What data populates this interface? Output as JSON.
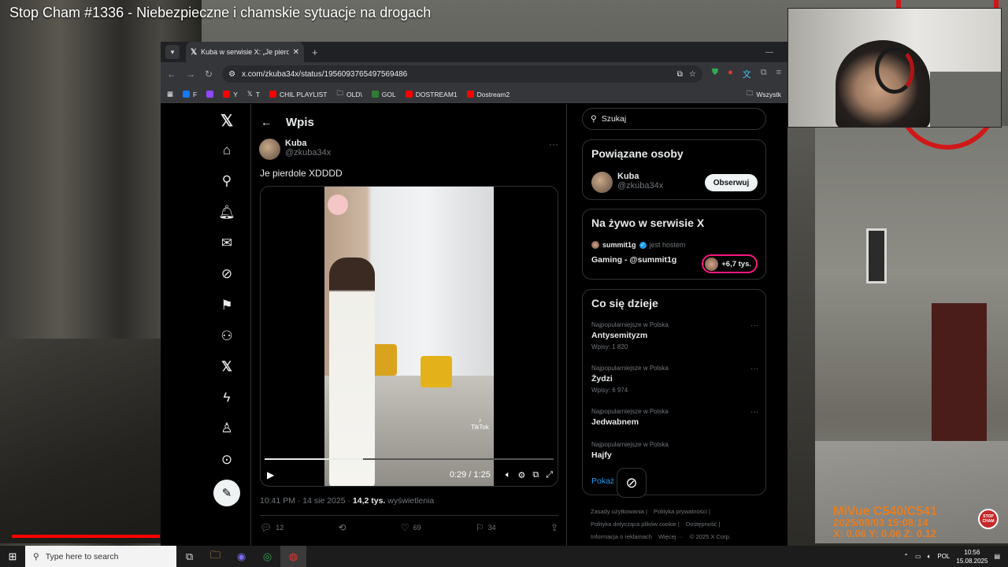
{
  "video_title": "Stop Cham #1336 - Niebezpieczne i chamskie sytuacje na drogach",
  "browser": {
    "tab_title": "Kuba w serwisie X: „Je pierdole",
    "url": "x.com/zkuba34x/status/1956093765497569486",
    "bookmarks": [
      "F",
      "Y",
      "T",
      "CHIL PLAYLIST",
      "OLD\\",
      "GOL",
      "DOSTREAM1",
      "Dostream2"
    ],
    "bookmarks_right": "Wszystk"
  },
  "x": {
    "header_title": "Wpis",
    "post": {
      "author_name": "Kuba",
      "author_handle": "@zkuba34x",
      "text": "Je pierdole XDDDD",
      "video_time": "0:29 / 1:25",
      "video_progress": 0.34,
      "tiktok_label": "TikTok",
      "time": "10:41 PM · 14 sie 2025 · ",
      "views": "14,2 tys.",
      "views_label": "wyświetlenia",
      "replies": "12",
      "likes": "69",
      "bookmarks": "34"
    },
    "search_placeholder": "Szukaj",
    "related": {
      "title": "Powiązane osoby",
      "name": "Kuba",
      "handle": "@zkuba34x",
      "follow_label": "Obserwuj"
    },
    "live": {
      "title": "Na żywo w serwisie X",
      "host_name": "summit1g",
      "host_suffix": "jest hostem",
      "stream_title": "Gaming - @summit1g",
      "count": "+6,7 tys."
    },
    "trends": {
      "title": "Co się dzieje",
      "items": [
        {
          "category": "Najpopularniejsze w Polska",
          "name": "Antysemityzm",
          "count": "Wpisy: 1 820"
        },
        {
          "category": "Najpopularniejsze w Polska",
          "name": "Żydzi",
          "count": "Wpisy: 6 974"
        },
        {
          "category": "Najpopularniejsze w Polska",
          "name": "Jedwabnem",
          "count": ""
        },
        {
          "category": "Najpopularniejsze w Polska",
          "name": "Hajfy",
          "count": ""
        }
      ],
      "show_more": "Pokaż więcej"
    },
    "footer": [
      "Zasady użytkowania |",
      "Polityka prywatności |",
      "Polityka dotycząca plików cookie |",
      "Dostępność |",
      "Informacja o reklamach",
      "Więcej ···",
      "© 2025 X Corp."
    ]
  },
  "dashcam": {
    "model": "MiVue C540/C541",
    "datetime": "2025/08/03 15:08:14",
    "gsensor": "X: 0.06   Y: 0.06   Z: 0.12",
    "badge": "STOP CHAM"
  },
  "taskbar": {
    "search_placeholder": "Type here to search",
    "lang": "POL",
    "time": "10:56",
    "date": "15.08.2025"
  },
  "colors": {
    "accent": "#1d9bf0",
    "live": "#f91880",
    "youtube_red": "#ff0000",
    "dashcam_text": "#e67e22"
  }
}
